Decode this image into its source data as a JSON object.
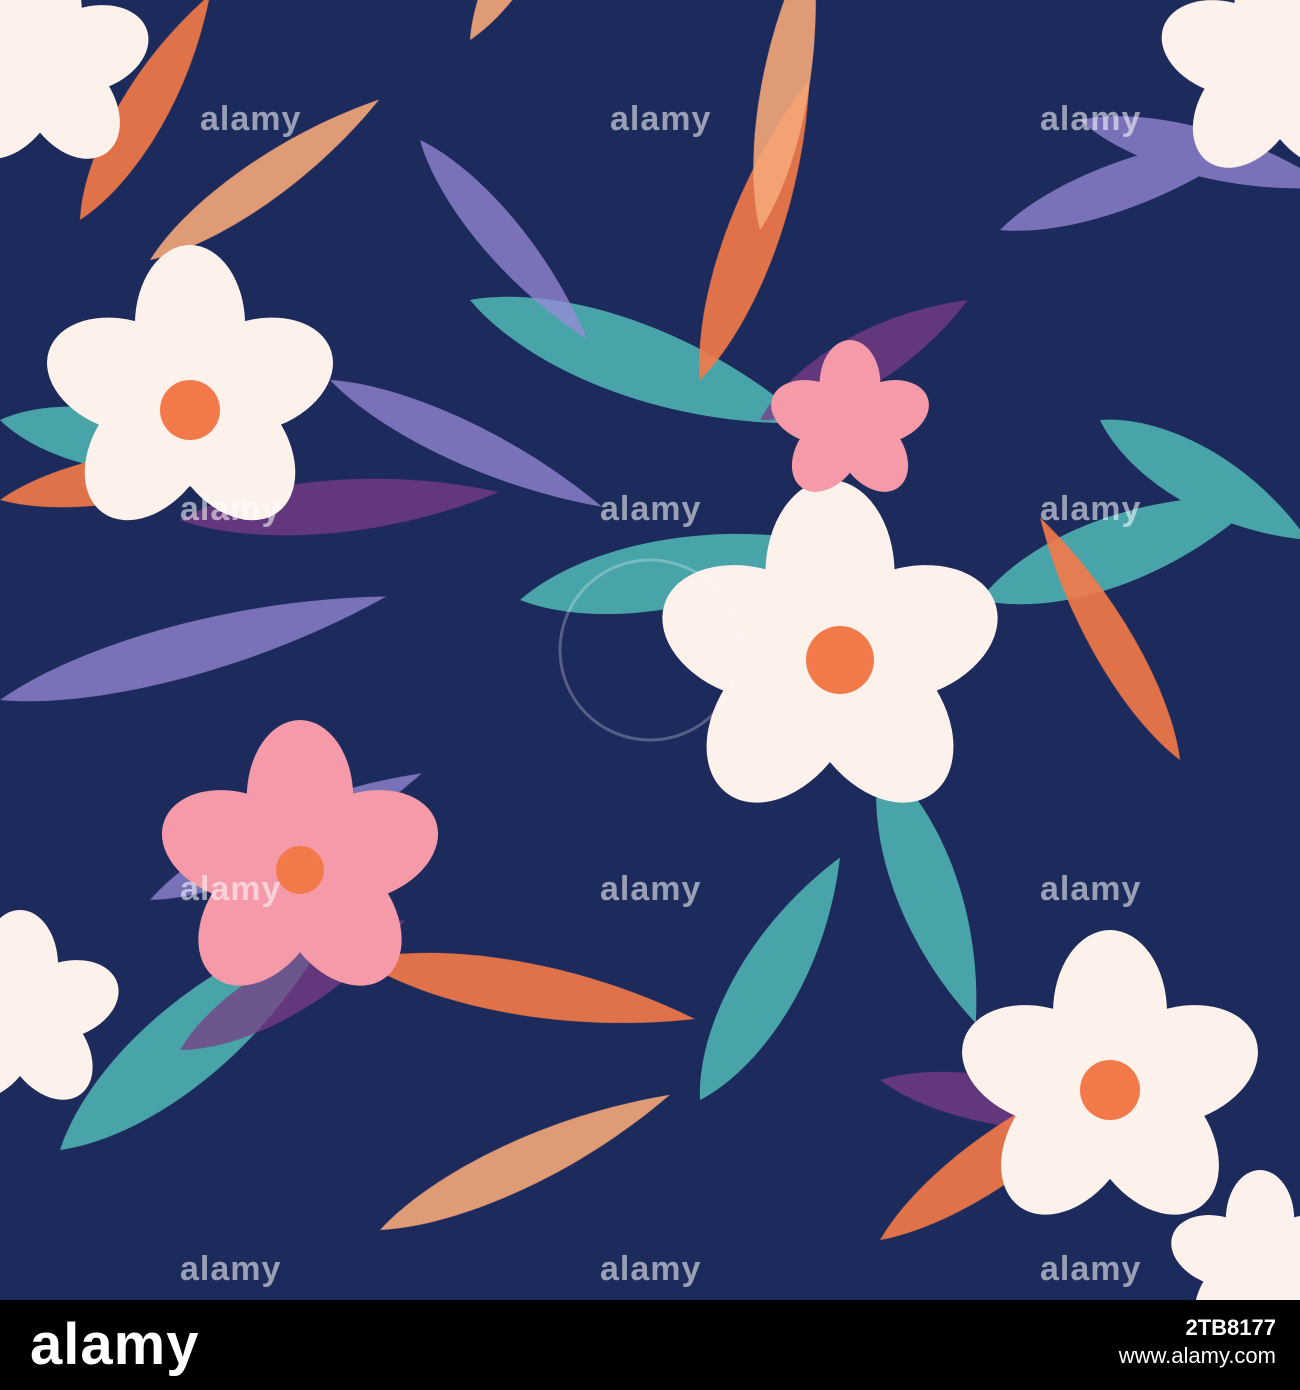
{
  "image": {
    "subject": "seamless tropical floral pattern",
    "palette": {
      "background": "#1d2a5c",
      "teal": "#4fb3b3",
      "orange": "#f27a4a",
      "peach": "#f5a77a",
      "pink": "#f49aa8",
      "cream": "#fdf1ec",
      "lavender": "#9a8bd8",
      "plum": "#7a3d86"
    }
  },
  "watermark": {
    "text": "alamy"
  },
  "footer": {
    "logo": "alamy",
    "image_id": "2TB8177",
    "site": "www.alamy.com"
  }
}
